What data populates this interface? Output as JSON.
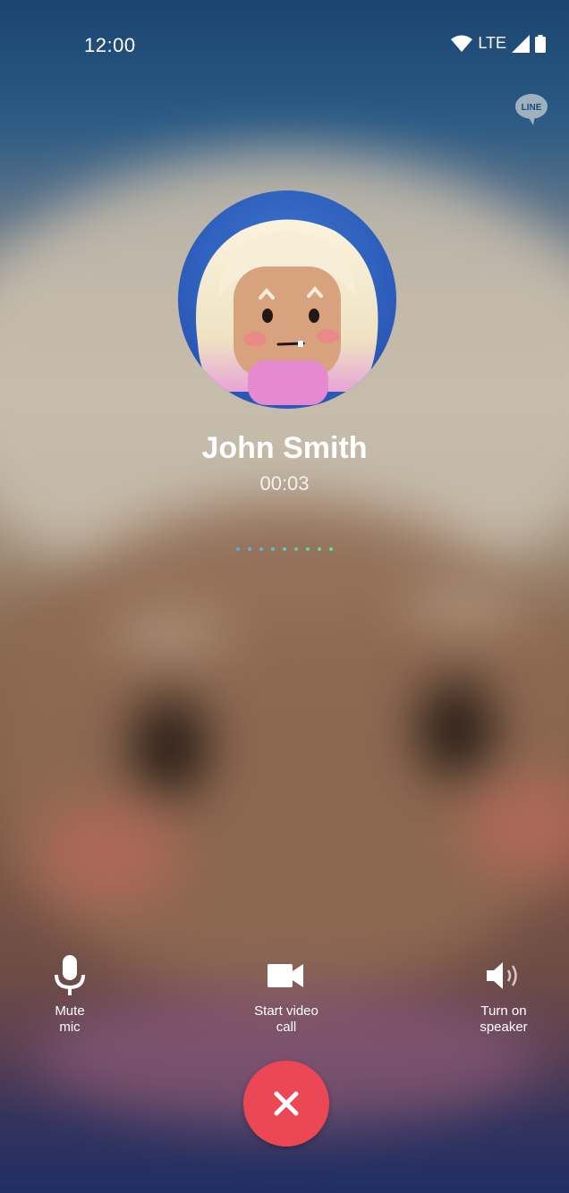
{
  "status_bar": {
    "time": "12:00",
    "network": "LTE",
    "icons": [
      "wifi-icon",
      "signal-icon",
      "battery-icon"
    ]
  },
  "app": {
    "logo_text": "LINE"
  },
  "call": {
    "contact_name": "John Smith",
    "duration": "00:03",
    "dot_colors": [
      "#5aa9ef",
      "#5ab1e2",
      "#5ab9d4",
      "#5ac0c6",
      "#5ac8b8",
      "#5ad0aa",
      "#5ad89c",
      "#5ae08e",
      "#5ae880"
    ]
  },
  "controls": {
    "mute": {
      "label_line1": "Mute",
      "label_line2": "mic",
      "icon": "microphone-icon"
    },
    "video": {
      "label_line1": "Start video",
      "label_line2": "call",
      "icon": "video-camera-icon"
    },
    "speaker": {
      "label_line1": "Turn on",
      "label_line2": "speaker",
      "icon": "speaker-icon"
    },
    "end_call": {
      "icon": "close-icon",
      "color": "#ec4755"
    }
  }
}
